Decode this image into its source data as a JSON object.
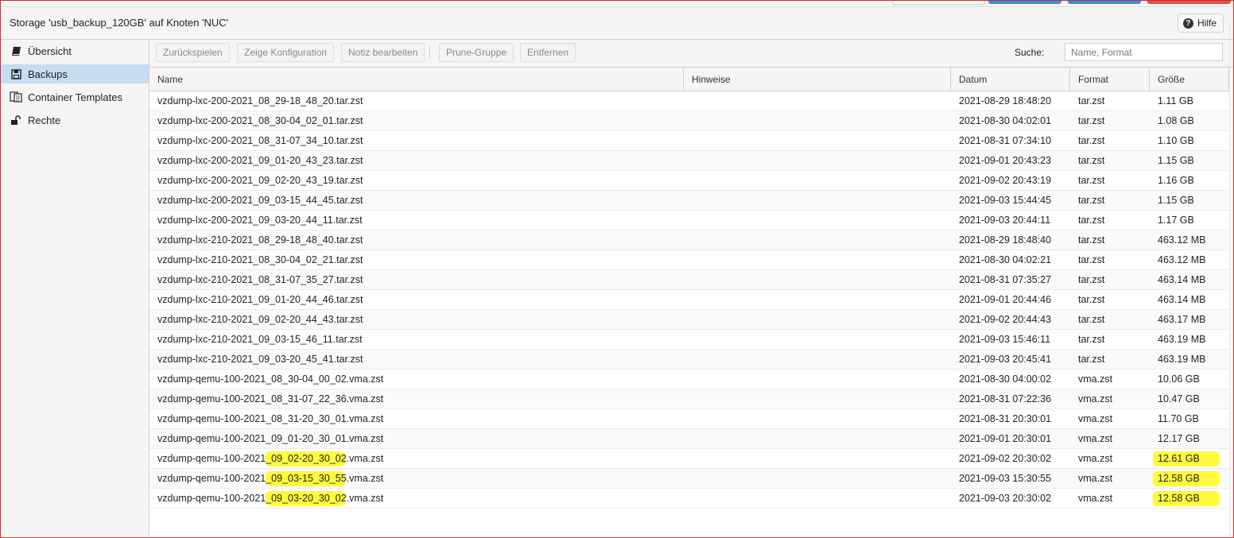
{
  "header": {
    "title": "Storage 'usb_backup_120GB' auf Knoten 'NUC'",
    "help_label": "Hilfe"
  },
  "sidebar": {
    "items": [
      {
        "label": "Übersicht",
        "icon": "book-icon",
        "active": false
      },
      {
        "label": "Backups",
        "icon": "floppy-icon",
        "active": true
      },
      {
        "label": "Container Templates",
        "icon": "file-copy-icon",
        "active": false
      },
      {
        "label": "Rechte",
        "icon": "unlock-icon",
        "active": false
      }
    ]
  },
  "toolbar": {
    "restore_label": "Zurückspielen",
    "config_label": "Zeige Konfiguration",
    "notes_label": "Notiz bearbeiten",
    "prune_label": "Prune-Gruppe",
    "remove_label": "Entfernen",
    "search_label": "Suche:",
    "search_placeholder": "Name, Format",
    "search_value": ""
  },
  "table": {
    "columns": [
      "Name",
      "Hinweise",
      "Datum",
      "Format",
      "Größe"
    ],
    "rows": [
      {
        "name": "vzdump-lxc-200-2021_08_29-18_48_20.tar.zst",
        "notes": "",
        "date": "2021-08-29 18:48:20",
        "format": "tar.zst",
        "size": "1.11 GB"
      },
      {
        "name": "vzdump-lxc-200-2021_08_30-04_02_01.tar.zst",
        "notes": "",
        "date": "2021-08-30 04:02:01",
        "format": "tar.zst",
        "size": "1.08 GB"
      },
      {
        "name": "vzdump-lxc-200-2021_08_31-07_34_10.tar.zst",
        "notes": "",
        "date": "2021-08-31 07:34:10",
        "format": "tar.zst",
        "size": "1.10 GB"
      },
      {
        "name": "vzdump-lxc-200-2021_09_01-20_43_23.tar.zst",
        "notes": "",
        "date": "2021-09-01 20:43:23",
        "format": "tar.zst",
        "size": "1.15 GB"
      },
      {
        "name": "vzdump-lxc-200-2021_09_02-20_43_19.tar.zst",
        "notes": "",
        "date": "2021-09-02 20:43:19",
        "format": "tar.zst",
        "size": "1.16 GB"
      },
      {
        "name": "vzdump-lxc-200-2021_09_03-15_44_45.tar.zst",
        "notes": "",
        "date": "2021-09-03 15:44:45",
        "format": "tar.zst",
        "size": "1.15 GB"
      },
      {
        "name": "vzdump-lxc-200-2021_09_03-20_44_11.tar.zst",
        "notes": "",
        "date": "2021-09-03 20:44:11",
        "format": "tar.zst",
        "size": "1.17 GB"
      },
      {
        "name": "vzdump-lxc-210-2021_08_29-18_48_40.tar.zst",
        "notes": "",
        "date": "2021-08-29 18:48:40",
        "format": "tar.zst",
        "size": "463.12 MB"
      },
      {
        "name": "vzdump-lxc-210-2021_08_30-04_02_21.tar.zst",
        "notes": "",
        "date": "2021-08-30 04:02:21",
        "format": "tar.zst",
        "size": "463.12 MB"
      },
      {
        "name": "vzdump-lxc-210-2021_08_31-07_35_27.tar.zst",
        "notes": "",
        "date": "2021-08-31 07:35:27",
        "format": "tar.zst",
        "size": "463.14 MB"
      },
      {
        "name": "vzdump-lxc-210-2021_09_01-20_44_46.tar.zst",
        "notes": "",
        "date": "2021-09-01 20:44:46",
        "format": "tar.zst",
        "size": "463.14 MB"
      },
      {
        "name": "vzdump-lxc-210-2021_09_02-20_44_43.tar.zst",
        "notes": "",
        "date": "2021-09-02 20:44:43",
        "format": "tar.zst",
        "size": "463.17 MB"
      },
      {
        "name": "vzdump-lxc-210-2021_09_03-15_46_11.tar.zst",
        "notes": "",
        "date": "2021-09-03 15:46:11",
        "format": "tar.zst",
        "size": "463.19 MB"
      },
      {
        "name": "vzdump-lxc-210-2021_09_03-20_45_41.tar.zst",
        "notes": "",
        "date": "2021-09-03 20:45:41",
        "format": "tar.zst",
        "size": "463.19 MB"
      },
      {
        "name": "vzdump-qemu-100-2021_08_30-04_00_02.vma.zst",
        "notes": "",
        "date": "2021-08-30 04:00:02",
        "format": "vma.zst",
        "size": "10.06 GB"
      },
      {
        "name": "vzdump-qemu-100-2021_08_31-07_22_36.vma.zst",
        "notes": "",
        "date": "2021-08-31 07:22:36",
        "format": "vma.zst",
        "size": "10.47 GB"
      },
      {
        "name": "vzdump-qemu-100-2021_08_31-20_30_01.vma.zst",
        "notes": "",
        "date": "2021-08-31 20:30:01",
        "format": "vma.zst",
        "size": "11.70 GB"
      },
      {
        "name": "vzdump-qemu-100-2021_09_01-20_30_01.vma.zst",
        "notes": "",
        "date": "2021-09-01 20:30:01",
        "format": "vma.zst",
        "size": "12.17 GB"
      },
      {
        "name": "vzdump-qemu-100-2021_09_02-20_30_02.vma.zst",
        "notes": "",
        "date": "2021-09-02 20:30:02",
        "format": "vma.zst",
        "size": "12.61 GB",
        "highlight": true
      },
      {
        "name": "vzdump-qemu-100-2021_09_03-15_30_55.vma.zst",
        "notes": "",
        "date": "2021-09-03 15:30:55",
        "format": "vma.zst",
        "size": "12.58 GB",
        "highlight": true
      },
      {
        "name": "vzdump-qemu-100-2021_09_03-20_30_02.vma.zst",
        "notes": "",
        "date": "2021-09-03 20:30:02",
        "format": "vma.zst",
        "size": "12.58 GB",
        "highlight": true
      }
    ]
  },
  "colors": {
    "selected_nav": "#c5dcf1",
    "highlighter": "#fdfb3c",
    "frame": "#d9282b"
  }
}
